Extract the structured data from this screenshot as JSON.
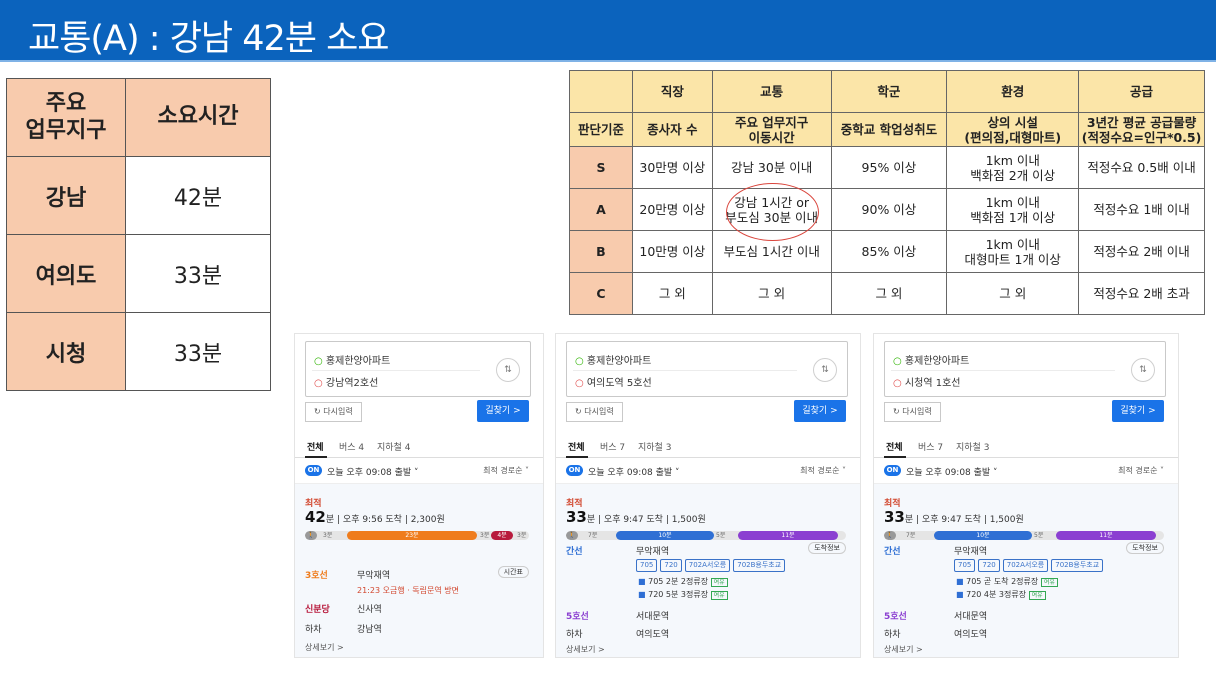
{
  "header": {
    "title": "교통(A) : 강남 42분 소요"
  },
  "commute": {
    "col_area": "주요\n업무지구",
    "col_time": "소요시간",
    "rows": [
      {
        "area": "강남",
        "time": "42분"
      },
      {
        "area": "여의도",
        "time": "33분"
      },
      {
        "area": "시청",
        "time": "33분"
      }
    ]
  },
  "criteria": {
    "top_headers": [
      "",
      "직장",
      "교통",
      "학군",
      "환경",
      "공급"
    ],
    "sub_headers": [
      "판단기준",
      "종사자 수",
      "주요 업무지구\n이동시간",
      "중학교 학업성취도",
      "상의 시설\n(편의점,대형마트)",
      "3년간 평균 공급물량\n(적정수요=인구*0.5)"
    ],
    "rows": [
      [
        "S",
        "30만명 이상",
        "강남 30분 이내",
        "95% 이상",
        "1km 이내\n백화점 2개 이상",
        "적정수요 0.5배 이내"
      ],
      [
        "A",
        "20만명 이상",
        "강남 1시간 or\n부도심 30분 이내",
        "90% 이상",
        "1km 이내\n백화점 1개 이상",
        "적정수요 1배 이내"
      ],
      [
        "B",
        "10만명 이상",
        "부도심 1시간 이내",
        "85% 이상",
        "1km 이내\n대형마트 1개 이상",
        "적정수요 2배 이내"
      ],
      [
        "C",
        "그 외",
        "그 외",
        "그 외",
        "그 외",
        "적정수요 2배 초과"
      ]
    ]
  },
  "panels": [
    {
      "origin": "홍제한양아파트",
      "dest": "강남역2호선",
      "reset": "다시입력",
      "find": "길찾기 >",
      "tabs": [
        "전체",
        "버스 4",
        "지하철 4"
      ],
      "on": "ON",
      "depart": "오늘 오후 09:08 출발 ˅",
      "sort": "최적 경로순 ˅",
      "label": "최적",
      "minutes": "42",
      "summary": "분 | 오후 9:56 도착 | 2,300원",
      "steps": [
        {
          "line": "3호선",
          "text": "무악재역",
          "sub": "21:23 오금행 · 독립문역 방면"
        },
        {
          "line": "신분당",
          "text": "신사역",
          "sub": ""
        },
        {
          "line": "하차",
          "text": "강남역",
          "sub": ""
        }
      ],
      "more": "상세보기 >"
    },
    {
      "origin": "홍제한양아파트",
      "dest": "여의도역 5호선",
      "reset": "다시입력",
      "find": "길찾기 >",
      "tabs": [
        "전체",
        "버스 7",
        "지하철 3"
      ],
      "on": "ON",
      "depart": "오늘 오후 09:08 출발 ˅",
      "sort": "최적 경로순 ˅",
      "label": "최적",
      "minutes": "33",
      "summary": "분 | 오후 9:47 도착 | 1,500원",
      "steps": [
        {
          "line": "간선",
          "text": "무악재역",
          "sub": ""
        },
        {
          "line": "5호선",
          "text": "서대문역",
          "sub": ""
        },
        {
          "line": "하차",
          "text": "여의도역",
          "sub": ""
        }
      ],
      "chips": [
        "705",
        "720",
        "702A서오릉",
        "702B용두초교"
      ],
      "bus_lines": [
        "705  2분 2정류장",
        "720  5분 3정류장"
      ],
      "more": "상세보기 >"
    },
    {
      "origin": "홍제한양아파트",
      "dest": "시청역 1호선",
      "reset": "다시입력",
      "find": "길찾기 >",
      "tabs": [
        "전체",
        "버스 7",
        "지하철 3"
      ],
      "on": "ON",
      "depart": "오늘 오후 09:08 출발 ˅",
      "sort": "최적 경로순 ˅",
      "label": "최적",
      "minutes": "33",
      "summary": "분 | 오후 9:47 도착 | 1,500원",
      "steps": [
        {
          "line": "간선",
          "text": "무악재역",
          "sub": ""
        },
        {
          "line": "5호선",
          "text": "서대문역",
          "sub": ""
        },
        {
          "line": "하차",
          "text": "여의도역",
          "sub": ""
        }
      ],
      "chips": [
        "705",
        "720",
        "702A서오릉",
        "702B용두초교"
      ],
      "bus_lines": [
        "705  곧 도착 2정류장",
        "720  4분 3정류장"
      ],
      "more": "상세보기 >"
    }
  ],
  "colors": {
    "title_bg": "#0b63bd",
    "header_peach": "#f8cbad",
    "header_yellow": "#fbe5a8",
    "line3": "#ef7c1c",
    "line_sinbundang": "#b81a3c",
    "line5": "#8b3fd1",
    "bus_blue": "#2f6fd4"
  }
}
